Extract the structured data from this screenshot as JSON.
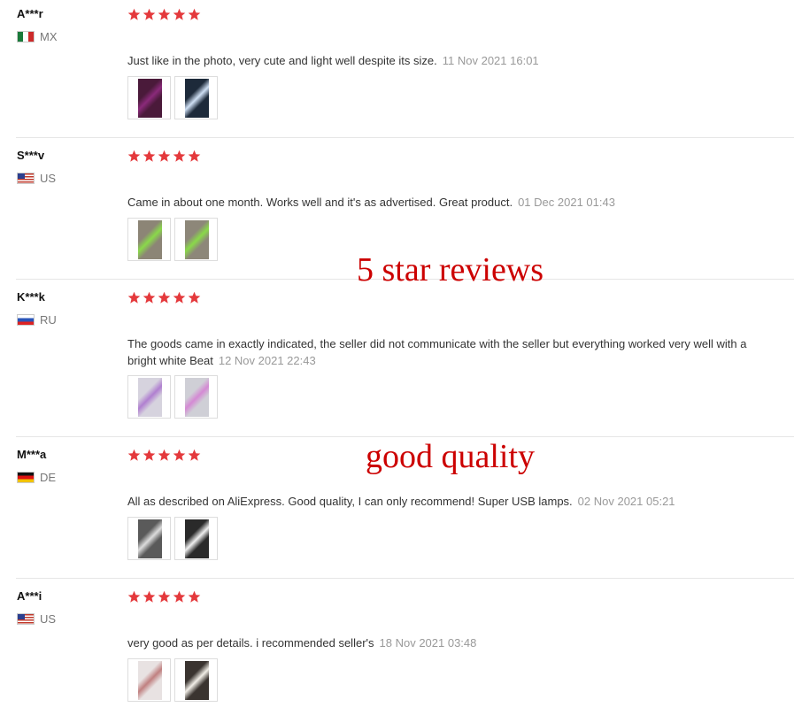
{
  "reviews": [
    {
      "name": "A***r",
      "country": "MX",
      "flag": "mx",
      "rating": 5,
      "text": "Just like in the photo, very cute and light well despite its size.",
      "date": "11 Nov 2021 16:01",
      "photos": [
        {
          "bg": "#4a1a3a",
          "fg": "#8a2a7a"
        },
        {
          "bg": "#1d2a3a",
          "fg": "#cfe0f5"
        }
      ]
    },
    {
      "name": "S***v",
      "country": "US",
      "flag": "us",
      "rating": 5,
      "text": "Came in about one month. Works well and it's as advertised. Great product.",
      "date": "01 Dec 2021 01:43",
      "photos": [
        {
          "bg": "#8c8576",
          "fg": "#8ad94a"
        },
        {
          "bg": "#8d8779",
          "fg": "#8ad94a"
        }
      ]
    },
    {
      "name": "K***k",
      "country": "RU",
      "flag": "ru",
      "rating": 5,
      "text": "The goods came in exactly indicated, the seller did not communicate with the seller but everything worked very well with a bright white Beat",
      "date": "12 Nov 2021 22:43",
      "photos": [
        {
          "bg": "#d6d3de",
          "fg": "#b07fd0"
        },
        {
          "bg": "#cfcfd6",
          "fg": "#d48ad4"
        }
      ]
    },
    {
      "name": "M***a",
      "country": "DE",
      "flag": "de",
      "rating": 5,
      "text": "All as described on AliExpress. Good quality, I can only recommend! Super USB lamps.",
      "date": "02 Nov 2021 05:21",
      "photos": [
        {
          "bg": "#5a5a5a",
          "fg": "#dcdcdc"
        },
        {
          "bg": "#2a2a2a",
          "fg": "#f0f0f0"
        }
      ]
    },
    {
      "name": "A***i",
      "country": "US",
      "flag": "us",
      "rating": 5,
      "text": "very good as per details. i recommended seller's",
      "date": "18 Nov 2021 03:48",
      "photos": [
        {
          "bg": "#e8e2e2",
          "fg": "#c08080"
        },
        {
          "bg": "#3a3430",
          "fg": "#f2efe8"
        }
      ]
    }
  ],
  "overlays": {
    "five_star": "5 star reviews",
    "good_quality": "good quality"
  },
  "colors": {
    "star": "#e4393c",
    "overlay_text": "#cc0000",
    "date": "#999999",
    "divider": "#e6e6e6"
  }
}
